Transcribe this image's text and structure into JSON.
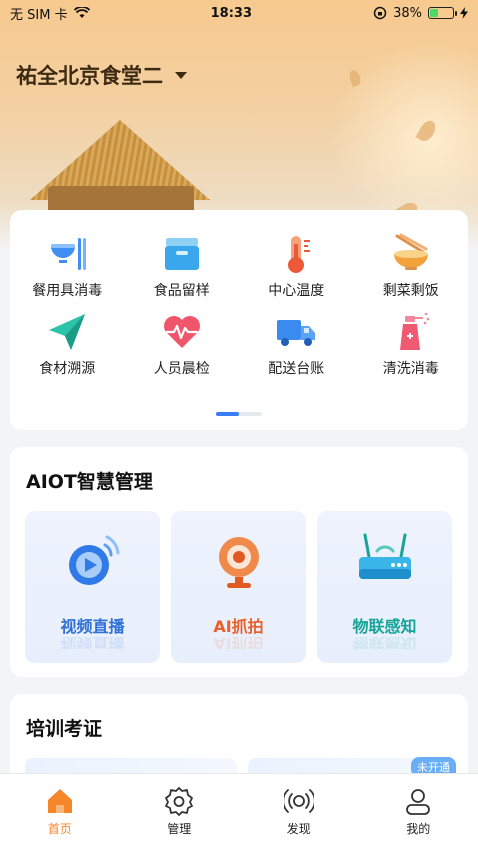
{
  "status_bar": {
    "carrier": "无 SIM 卡",
    "time": "18:33",
    "battery": "38%",
    "battery_level": 0.38
  },
  "header": {
    "location": "祐全北京食堂二"
  },
  "functions": {
    "items": [
      {
        "label": "餐用具消毒",
        "icon": "bowl-chopsticks-icon"
      },
      {
        "label": "食品留样",
        "icon": "food-box-icon"
      },
      {
        "label": "中心温度",
        "icon": "thermometer-icon"
      },
      {
        "label": "剩菜剩饭",
        "icon": "leftover-bowl-icon"
      },
      {
        "label": "食材溯源",
        "icon": "paper-plane-icon"
      },
      {
        "label": "人员晨检",
        "icon": "heart-pulse-icon"
      },
      {
        "label": "配送台账",
        "icon": "delivery-truck-icon"
      },
      {
        "label": "清洗消毒",
        "icon": "spray-bottle-icon"
      }
    ],
    "page_index": 1,
    "page_count": 2
  },
  "aiot": {
    "title": "AIOT智慧管理",
    "tiles": [
      {
        "label": "视频直播",
        "color": "#2f6fd8",
        "icon": "video-live-icon"
      },
      {
        "label": "AI抓拍",
        "color": "#e8612c",
        "icon": "camera-icon"
      },
      {
        "label": "物联感知",
        "color": "#17a398",
        "icon": "router-icon"
      }
    ]
  },
  "training": {
    "title": "培训考证",
    "badge": "未开通"
  },
  "tabbar": {
    "tabs": [
      {
        "label": "首页",
        "icon": "home-icon",
        "active": true
      },
      {
        "label": "管理",
        "icon": "gear-icon",
        "active": false
      },
      {
        "label": "发现",
        "icon": "broadcast-icon",
        "active": false
      },
      {
        "label": "我的",
        "icon": "user-icon",
        "active": false
      }
    ]
  },
  "colors": {
    "accent": "#f5862a",
    "primary_blue": "#3a7cf5"
  }
}
